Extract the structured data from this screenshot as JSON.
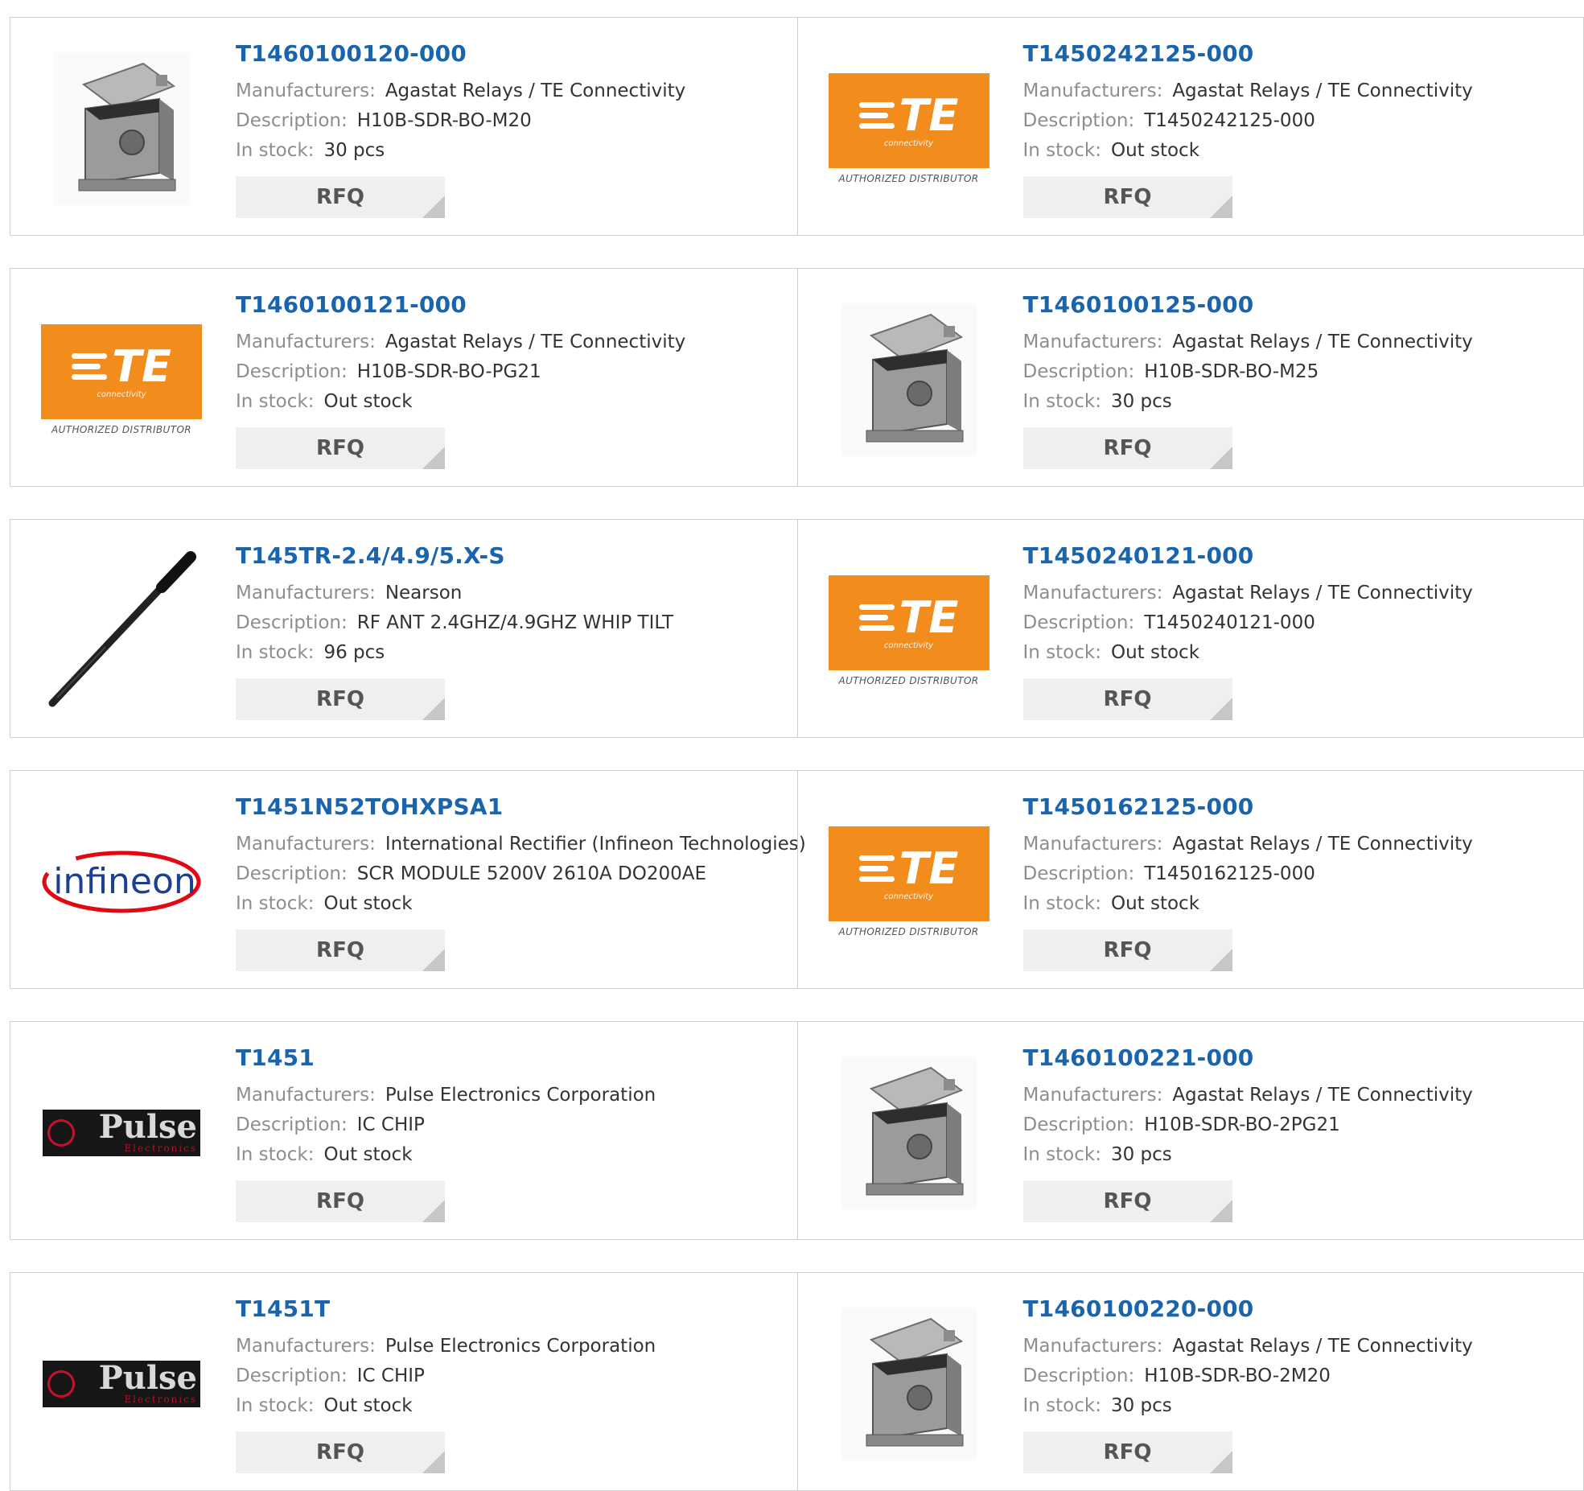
{
  "labels": {
    "manufacturers": "Manufacturers:",
    "description": "Description:",
    "in_stock": "In stock:",
    "rfq": "RFQ"
  },
  "logos": {
    "te_word": "TE",
    "te_sub": "connectivity",
    "te_auth": "AUTHORIZED DISTRIBUTOR",
    "infineon": "infineon",
    "pulse_word": "Pulse",
    "pulse_sub": "Electronics"
  },
  "colors": {
    "link": "#1a64ad",
    "te_orange": "#f28c1c",
    "infineon_blue": "#1d3f8f",
    "infineon_red": "#e30613"
  },
  "products": [
    {
      "pn": "T1460100120-000",
      "manufacturer": "Agastat Relays / TE Connectivity",
      "description": "H10B-SDR-BO-M20",
      "stock": "30 pcs",
      "image": "housing-image"
    },
    {
      "pn": "T1450242125-000",
      "manufacturer": "Agastat Relays / TE Connectivity",
      "description": "T1450242125-000",
      "stock": "Out stock",
      "image": "te-logo"
    },
    {
      "pn": "T1460100121-000",
      "manufacturer": "Agastat Relays / TE Connectivity",
      "description": "H10B-SDR-BO-PG21",
      "stock": "Out stock",
      "image": "te-logo"
    },
    {
      "pn": "T1460100125-000",
      "manufacturer": "Agastat Relays / TE Connectivity",
      "description": "H10B-SDR-BO-M25",
      "stock": "30 pcs",
      "image": "housing-image"
    },
    {
      "pn": "T145TR-2.4/4.9/5.X-S",
      "manufacturer": "Nearson",
      "description": "RF ANT 2.4GHZ/4.9GHZ WHIP TILT",
      "stock": "96 pcs",
      "image": "antenna-image"
    },
    {
      "pn": "T1450240121-000",
      "manufacturer": "Agastat Relays / TE Connectivity",
      "description": "T1450240121-000",
      "stock": "Out stock",
      "image": "te-logo"
    },
    {
      "pn": "T1451N52TOHXPSA1",
      "manufacturer": "International Rectifier (Infineon Technologies)",
      "description": "SCR MODULE 5200V 2610A DO200AE",
      "stock": "Out stock",
      "image": "infineon-logo"
    },
    {
      "pn": "T1450162125-000",
      "manufacturer": "Agastat Relays / TE Connectivity",
      "description": "T1450162125-000",
      "stock": "Out stock",
      "image": "te-logo"
    },
    {
      "pn": "T1451",
      "manufacturer": "Pulse Electronics Corporation",
      "description": "IC CHIP",
      "stock": "Out stock",
      "image": "pulse-logo"
    },
    {
      "pn": "T1460100221-000",
      "manufacturer": "Agastat Relays / TE Connectivity",
      "description": "H10B-SDR-BO-2PG21",
      "stock": "30 pcs",
      "image": "housing-image"
    },
    {
      "pn": "T1451T",
      "manufacturer": "Pulse Electronics Corporation",
      "description": "IC CHIP",
      "stock": "Out stock",
      "image": "pulse-logo"
    },
    {
      "pn": "T1460100220-000",
      "manufacturer": "Agastat Relays / TE Connectivity",
      "description": "H10B-SDR-BO-2M20",
      "stock": "30 pcs",
      "image": "housing-image"
    }
  ]
}
